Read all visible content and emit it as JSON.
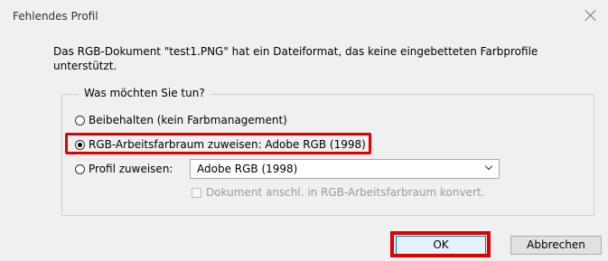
{
  "window": {
    "title": "Fehlendes Profil"
  },
  "message": "Das RGB-Dokument \"test1.PNG\" hat ein Dateiformat, das keine eingebetteten Farbprofile unterstützt.",
  "group": {
    "legend": "Was möchten Sie tun?",
    "options": [
      {
        "label": "Beibehalten (kein Farbmanagement)",
        "checked": false
      },
      {
        "label": "RGB-Arbeitsfarbraum zuweisen: Adobe RGB (1998)",
        "checked": true
      },
      {
        "label": "Profil zuweisen:",
        "checked": false
      }
    ],
    "profile_select": {
      "value": "Adobe RGB (1998)"
    },
    "convert_checkbox": {
      "label": "Dokument anschl. in RGB-Arbeitsfarbraum konvert.",
      "checked": false,
      "enabled": false
    }
  },
  "buttons": {
    "ok": "OK",
    "cancel": "Abbrechen"
  },
  "colors": {
    "highlight": "#e00000",
    "background": "#f0f0f0"
  }
}
